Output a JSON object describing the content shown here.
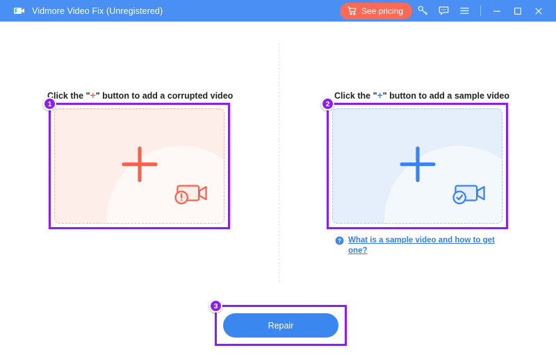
{
  "titlebar": {
    "app_name": "Vidmore Video Fix (Unregistered)",
    "logo_icon": "camcorder-logo-icon",
    "pricing_label": "See pricing",
    "pricing_icon": "shopping-cart-icon",
    "pricing_bg": "#fa6a55",
    "bar_bg": "#4a90f4",
    "icons": [
      {
        "name": "key-icon",
        "title": "Register"
      },
      {
        "name": "feedback-icon",
        "title": "Feedback"
      },
      {
        "name": "menu-icon",
        "title": "Menu"
      }
    ],
    "window_controls": [
      {
        "name": "minimize-button",
        "glyph": "minimize"
      },
      {
        "name": "maximize-button",
        "glyph": "maximize"
      },
      {
        "name": "close-button",
        "glyph": "close"
      }
    ]
  },
  "left_panel": {
    "heading_before": "Click the \"",
    "heading_plus": "+",
    "heading_after": "\" button to add a corrupted video",
    "badge": "1",
    "dropzone_name": "corrupted-video-dropzone",
    "plus_color": "#f4634f",
    "zone_bg": "#fdeeea",
    "zone_border": "#f2b4a4",
    "camera_icon": "camcorder-error-icon"
  },
  "right_panel": {
    "heading_before": "Click the \"",
    "heading_plus": "+",
    "heading_after": "\" button to add a sample video",
    "badge": "2",
    "dropzone_name": "sample-video-dropzone",
    "plus_color": "#3b82f2",
    "zone_bg": "#e4effb",
    "zone_border": "#a9c6ea",
    "camera_icon": "camcorder-check-icon",
    "help_link": "What is a sample video and how to get one?",
    "help_icon": "question-mark-icon",
    "link_color": "#2f7ff0"
  },
  "action": {
    "badge": "3",
    "repair_label": "Repair",
    "repair_bg": "#3b87f0"
  },
  "annotation_color": "#8a1ff0"
}
